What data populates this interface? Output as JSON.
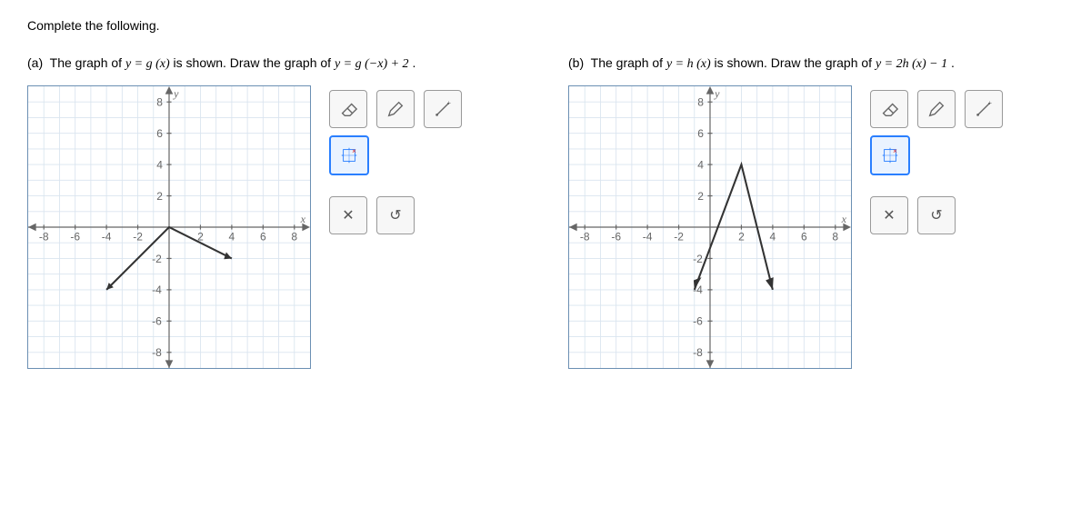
{
  "instruction": "Complete the following.",
  "problems": {
    "a": {
      "label": "(a)",
      "prompt_prefix": "The graph of ",
      "eq1": "y = g (x)",
      "prompt_mid": " is shown. Draw the graph of ",
      "eq2": "y = g (−x) + 2",
      "prompt_suffix": "."
    },
    "b": {
      "label": "(b)",
      "prompt_prefix": "The graph of ",
      "eq1": "y = h (x)",
      "prompt_mid": " is shown. Draw the graph of ",
      "eq2": "y = 2h (x) − 1",
      "prompt_suffix": "."
    }
  },
  "axes": {
    "x_label": "x",
    "y_label": "y",
    "min": -8,
    "max": 8,
    "ticks": [
      -8,
      -6,
      -4,
      -2,
      2,
      4,
      6,
      8
    ]
  },
  "toolbar": {
    "eraser": "eraser",
    "pen": "pen",
    "line": "line",
    "zoom": "zoom",
    "close": "✕",
    "reset": "↺"
  },
  "chart_data": [
    {
      "id": "a",
      "type": "line",
      "xlabel": "x",
      "ylabel": "y",
      "xlim": [
        -8,
        8
      ],
      "ylim": [
        -8,
        8
      ],
      "series": [
        {
          "name": "g(x)",
          "points": [
            [
              -4,
              -4
            ],
            [
              0,
              0
            ],
            [
              4,
              -2
            ]
          ]
        }
      ]
    },
    {
      "id": "b",
      "type": "line",
      "xlabel": "x",
      "ylabel": "y",
      "xlim": [
        -8,
        8
      ],
      "ylim": [
        -8,
        8
      ],
      "series": [
        {
          "name": "h(x)",
          "points": [
            [
              -1,
              -4
            ],
            [
              2,
              4
            ],
            [
              4,
              -4
            ]
          ]
        }
      ]
    }
  ]
}
